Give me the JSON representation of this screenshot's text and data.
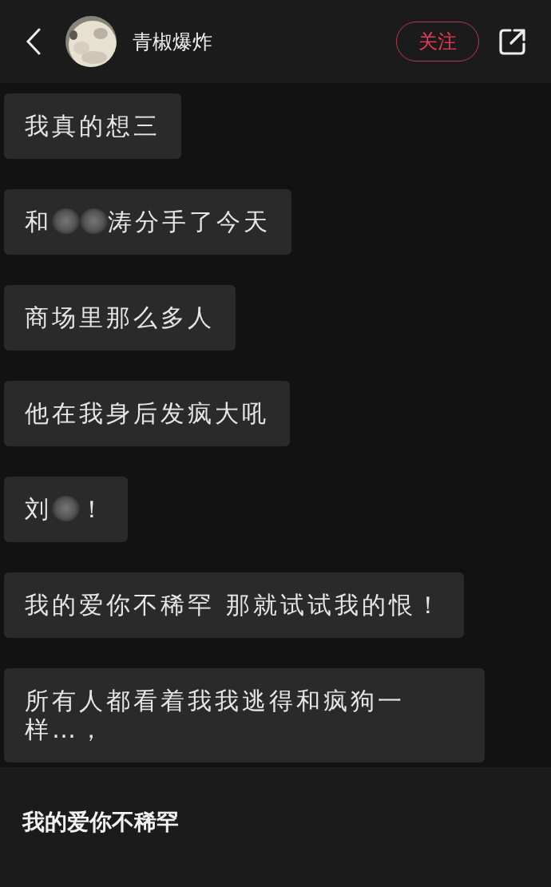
{
  "header": {
    "username": "青椒爆炸",
    "follow_button": "关注"
  },
  "messages": [
    {
      "segments": [
        {
          "kind": "text",
          "text": "我真的想三"
        }
      ]
    },
    {
      "segments": [
        {
          "kind": "text",
          "text": "和"
        },
        {
          "kind": "blur"
        },
        {
          "kind": "blur"
        },
        {
          "kind": "text",
          "text": "涛分手了今天"
        }
      ]
    },
    {
      "segments": [
        {
          "kind": "text",
          "text": "商场里那么多人"
        }
      ]
    },
    {
      "segments": [
        {
          "kind": "text",
          "text": "他在我身后发疯大吼"
        }
      ]
    },
    {
      "segments": [
        {
          "kind": "text",
          "text": "刘"
        },
        {
          "kind": "blur"
        },
        {
          "kind": "text",
          "text": "！"
        }
      ]
    },
    {
      "segments": [
        {
          "kind": "text",
          "text": "我的爱你不稀罕 那就试试我的恨！"
        }
      ]
    },
    {
      "segments": [
        {
          "kind": "text",
          "text": "所有人都看着我我逃得和疯狗一样…，"
        }
      ]
    }
  ],
  "footer": {
    "title": "我的爱你不稀罕"
  }
}
